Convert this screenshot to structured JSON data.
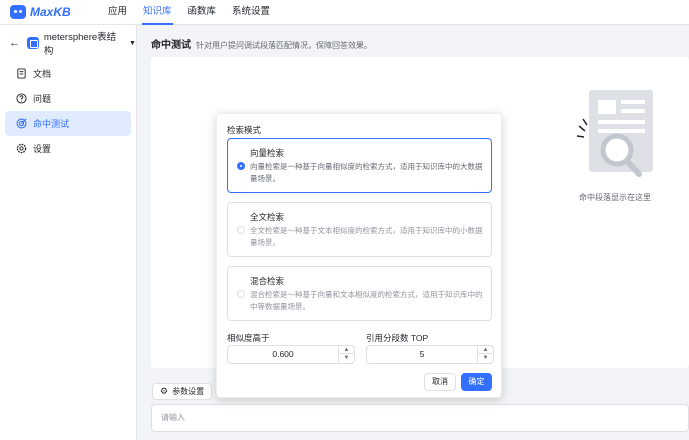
{
  "brand": {
    "name": "MaxKB",
    "accent": "#3370ff"
  },
  "nav": {
    "items": [
      {
        "label": "应用",
        "active": false
      },
      {
        "label": "知识库",
        "active": true
      },
      {
        "label": "函数库",
        "active": false
      },
      {
        "label": "系统设置",
        "active": false
      }
    ]
  },
  "sidebar": {
    "knowledge_base": "metersphere表结构",
    "items": [
      {
        "label": "文档",
        "icon": "document-icon"
      },
      {
        "label": "问题",
        "icon": "question-icon"
      },
      {
        "label": "命中测试",
        "icon": "target-icon",
        "active": true
      },
      {
        "label": "设置",
        "icon": "gear-icon"
      }
    ]
  },
  "page": {
    "title": "命中测试",
    "subtitle": "针对用户提问调试段落匹配情况，保障回答效果。",
    "empty_text": "命中段落显示在这里"
  },
  "params": {
    "button_label": "参数设置",
    "input_placeholder": "请输入"
  },
  "popover": {
    "section_label": "检索模式",
    "modes": [
      {
        "title": "向量检索",
        "desc": "向量检索是一种基于向量相似度的检索方式，适用于知识库中的大数据量场景。",
        "selected": true
      },
      {
        "title": "全文检索",
        "desc": "全文检索是一种基于文本相似度的检索方式，适用于知识库中的小数据量场景。",
        "selected": false
      },
      {
        "title": "混合检索",
        "desc": "混合检索是一种基于向量和文本相似度的检索方式，适用于知识库中的中等数据量场景。",
        "selected": false
      }
    ],
    "similarity_label": "相似度高于",
    "similarity_value": "0.600",
    "topn_label": "引用分段数 TOP",
    "topn_value": "5",
    "cancel_label": "取消",
    "confirm_label": "确定"
  }
}
